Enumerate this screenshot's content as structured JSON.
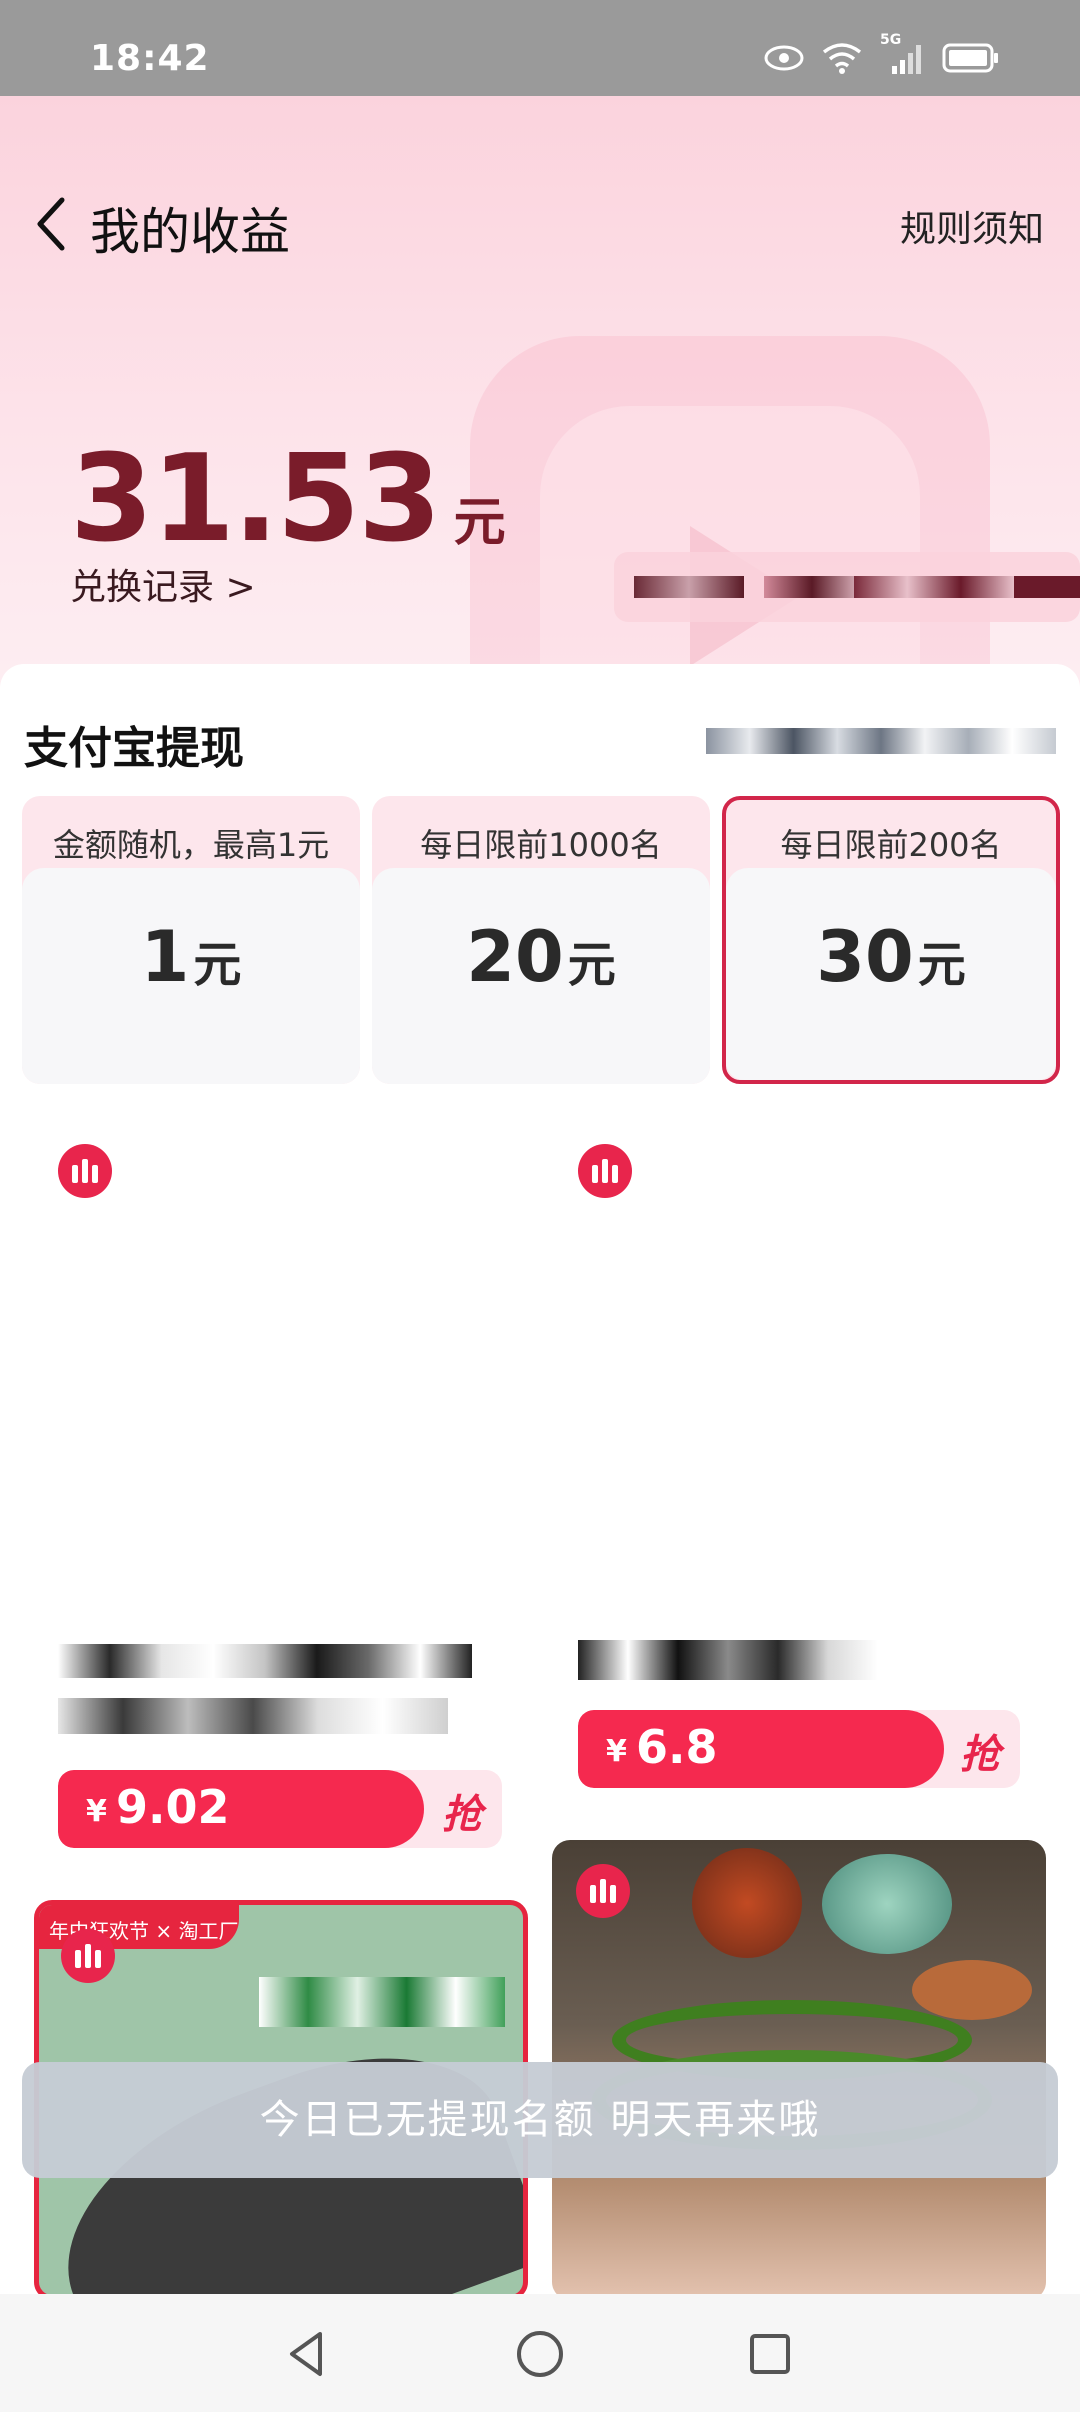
{
  "status_bar": {
    "time": "18:42",
    "network_label": "5G"
  },
  "header": {
    "title": "我的收益",
    "rules_link": "规则须知"
  },
  "balance": {
    "amount": "31.53",
    "unit": "元",
    "records_link": "兑换记录 >"
  },
  "withdraw": {
    "section_title": "支付宝提现",
    "options": [
      {
        "label": "金额随机，最高1元",
        "value": "1",
        "unit": "元",
        "selected": false
      },
      {
        "label": "每日限前1000名",
        "value": "20",
        "unit": "元",
        "selected": false
      },
      {
        "label": "每日限前200名",
        "value": "30",
        "unit": "元",
        "selected": true
      }
    ]
  },
  "feed": {
    "items": [
      {
        "price_symbol": "¥",
        "price": "9.02",
        "grab_label": "抢"
      },
      {
        "price_symbol": "¥",
        "price": "6.8",
        "grab_label": "抢"
      }
    ],
    "promo_tag": "年中狂欢节 × 淘工厂"
  },
  "toast": {
    "message": "今日已无提现名额 明天再来哦"
  },
  "colors": {
    "accent": "#e8254c",
    "balance": "#7a1c2a",
    "selected_border": "#d2264a"
  }
}
